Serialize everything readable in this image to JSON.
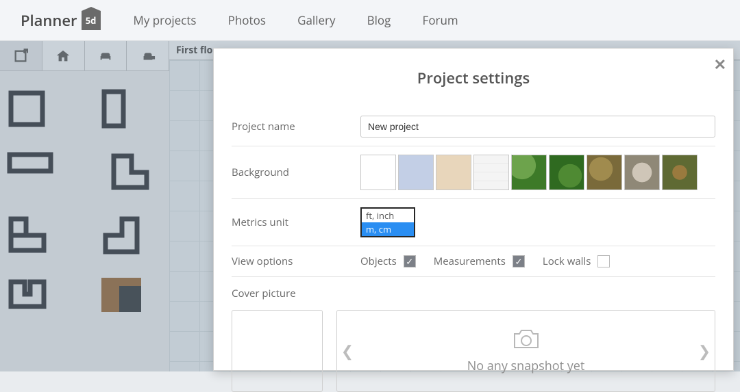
{
  "brand": {
    "name": "Planner",
    "badge": "5d"
  },
  "nav": [
    "My projects",
    "Photos",
    "Gallery",
    "Blog",
    "Forum"
  ],
  "floor": {
    "label": "First flo"
  },
  "modal": {
    "title": "Project settings",
    "labels": {
      "project_name": "Project name",
      "background": "Background",
      "metrics": "Metrics unit",
      "view": "View options",
      "cover": "Cover picture"
    },
    "project_name_value": "New project",
    "backgrounds": [
      {
        "id": "white",
        "css": "#ffffff"
      },
      {
        "id": "blue",
        "css": "#c3cfe6"
      },
      {
        "id": "beige",
        "css": "#e8d6bb"
      },
      {
        "id": "grid",
        "css": "repeating-linear-gradient(0deg,#f4f4f4,#f4f4f4 12px,#e9e9e9 12px,#e9e9e9 13px),repeating-linear-gradient(90deg,#f4f4f4,#f4f4f4 12px,#e9e9e9 12px,#e9e9e9 13px)"
      },
      {
        "id": "grass1",
        "css": "radial-gradient(circle at 30% 30%, #6da34c 0 40%, #3d7a28 41% 100%)"
      },
      {
        "id": "grass2",
        "css": "radial-gradient(circle at 60% 60%, #4f8a33 0 40%, #2f6a20 41% 100%)"
      },
      {
        "id": "sand",
        "css": "radial-gradient(circle at 40% 40%, #a08b4e 0 40%, #7a6a3a 41% 100%)"
      },
      {
        "id": "gravel",
        "css": "radial-gradient(circle at 50% 50%, #cfc6b8 0 40%, #8f8877 41% 100%)"
      },
      {
        "id": "dirt",
        "css": "radial-gradient(circle at 50% 50%, #9a7a3e 0 30%, #5f6a33 31% 100%)"
      }
    ],
    "metrics_options": [
      "ft, inch",
      "m, cm"
    ],
    "metrics_selected": "m, cm",
    "view_options": {
      "objects": {
        "label": "Objects",
        "checked": true
      },
      "measurements": {
        "label": "Measurements",
        "checked": true
      },
      "lockwalls": {
        "label": "Lock walls",
        "checked": false
      }
    },
    "cover": {
      "empty_text": "No any snapshot yet"
    }
  }
}
